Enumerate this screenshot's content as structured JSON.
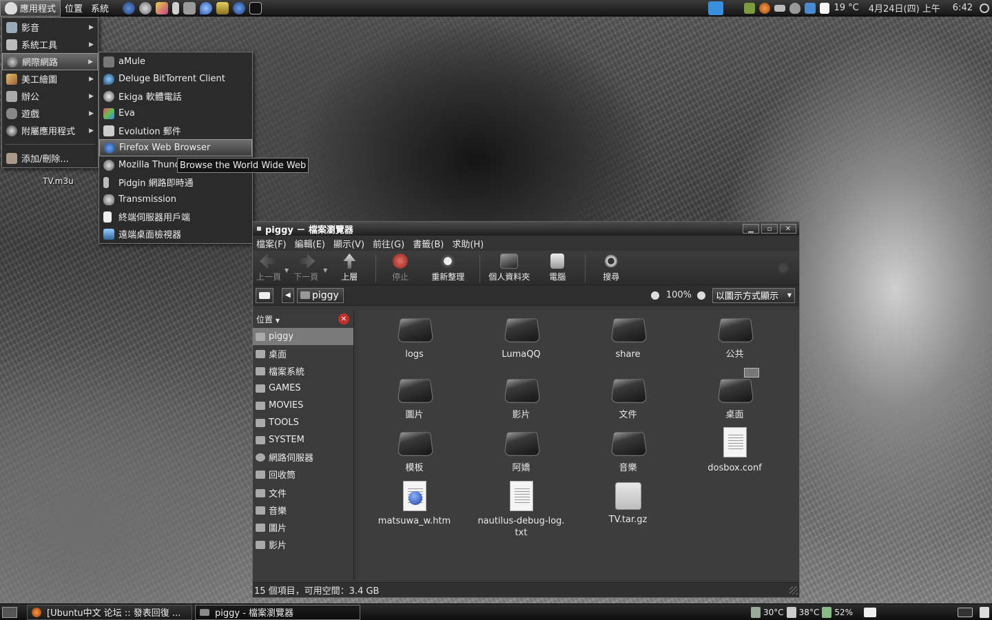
{
  "top_panel": {
    "menus": [
      "應用程式",
      "位置",
      "系統"
    ],
    "launchers": [
      "browser-icon",
      "disk-icon",
      "pidgin-icon",
      "notes-icon",
      "terminal-icon",
      "water-drop-icon",
      "book-icon",
      "help-icon",
      "terminal-icon"
    ],
    "tray": {
      "weather": "19 °C",
      "date": "4月24日(四) 上午",
      "time": "6:42"
    }
  },
  "apps_menu": {
    "items": [
      {
        "label": "影音",
        "icon": "multimedia-icon",
        "has_submenu": true
      },
      {
        "label": "系統工具",
        "icon": "tools-icon",
        "has_submenu": true
      },
      {
        "label": "網際網路",
        "icon": "network-icon",
        "has_submenu": true
      },
      {
        "label": "美工繪圖",
        "icon": "graphics-icon",
        "has_submenu": true
      },
      {
        "label": "辦公",
        "icon": "office-icon",
        "has_submenu": true
      },
      {
        "label": "遊戲",
        "icon": "games-icon",
        "has_submenu": true
      },
      {
        "label": "附屬應用程式",
        "icon": "accessories-icon",
        "has_submenu": true
      }
    ],
    "footer": "添加/刪除..."
  },
  "internet_submenu": {
    "items": [
      {
        "label": "aMule",
        "icon": "amule-icon"
      },
      {
        "label": "Deluge BitTorrent Client",
        "icon": "deluge-icon"
      },
      {
        "label": "Ekiga 軟體電話",
        "icon": "ekiga-icon"
      },
      {
        "label": "Eva",
        "icon": "eva-icon"
      },
      {
        "label": "Evolution 郵件",
        "icon": "evolution-icon"
      },
      {
        "label": "Firefox Web Browser",
        "icon": "firefox-icon"
      },
      {
        "label": "Mozilla Thund",
        "icon": "thunderbird-icon"
      },
      {
        "label": "Pidgin 網路即時通",
        "icon": "pidgin-icon"
      },
      {
        "label": "Transmission",
        "icon": "transmission-icon"
      },
      {
        "label": "終端伺服器用戶端",
        "icon": "terminal-client-icon"
      },
      {
        "label": "遠端桌面檢視器",
        "icon": "remote-desktop-icon"
      }
    ],
    "tooltip": "Browse the World Wide Web"
  },
  "desktop": {
    "icon_label": "TV.m3u"
  },
  "file_manager": {
    "title": "piggy － 檔案瀏覽器",
    "menubar": [
      "檔案(F)",
      "編輯(E)",
      "顯示(V)",
      "前往(G)",
      "書籤(B)",
      "求助(H)"
    ],
    "toolbar": [
      {
        "label": "上一頁",
        "icon": "back-arrow-icon",
        "disabled": true
      },
      {
        "label": "下一頁",
        "icon": "forward-arrow-icon",
        "disabled": true
      },
      {
        "label": "上層",
        "icon": "up-arrow-icon",
        "disabled": false
      },
      {
        "label": "停止",
        "icon": "stop-icon",
        "disabled": true
      },
      {
        "label": "重新整理",
        "icon": "reload-icon",
        "disabled": false
      },
      {
        "label": "個人資料夾",
        "icon": "home-icon",
        "disabled": false
      },
      {
        "label": "電腦",
        "icon": "computer-icon",
        "disabled": false
      },
      {
        "label": "搜尋",
        "icon": "search-icon",
        "disabled": false
      }
    ],
    "location": {
      "path": "piggy",
      "zoom": "100%",
      "view_mode": "以圖示方式顯示"
    },
    "sidebar": {
      "header": "位置",
      "items": [
        "piggy",
        "桌面",
        "檔案系統",
        "GAMES",
        "MOVIES",
        "TOOLS",
        "SYSTEM",
        "網路伺服器",
        "回收筒"
      ],
      "bookmarks": [
        "文件",
        "音樂",
        "圖片",
        "影片"
      ]
    },
    "files": [
      {
        "name": "logs",
        "type": "folder"
      },
      {
        "name": "LumaQQ",
        "type": "folder"
      },
      {
        "name": "share",
        "type": "folder"
      },
      {
        "name": "公共",
        "type": "folder"
      },
      {
        "name": "圖片",
        "type": "folder"
      },
      {
        "name": "影片",
        "type": "folder"
      },
      {
        "name": "文件",
        "type": "folder"
      },
      {
        "name": "桌面",
        "type": "folder"
      },
      {
        "name": "模板",
        "type": "folder"
      },
      {
        "name": "阿嬌",
        "type": "folder"
      },
      {
        "name": "音樂",
        "type": "folder"
      },
      {
        "name": "dosbox.conf",
        "type": "text"
      },
      {
        "name": "matsuwa_w.htm",
        "type": "html"
      },
      {
        "name": "nautilus-debug-log.txt",
        "type": "text"
      },
      {
        "name": "TV.tar.gz",
        "type": "archive"
      }
    ],
    "status": "15 個項目，可用空間：3.4 GB"
  },
  "bottom_panel": {
    "tasks": [
      {
        "label": "[Ubuntu中文 论坛 :: 發表回復 ...",
        "icon": "firefox-icon"
      },
      {
        "label": "piggy - 檔案瀏覽器",
        "icon": "folder-icon"
      }
    ],
    "indicators": {
      "cpu_temp": "30°C",
      "disk_temp": "38°C",
      "battery": "52%"
    }
  }
}
